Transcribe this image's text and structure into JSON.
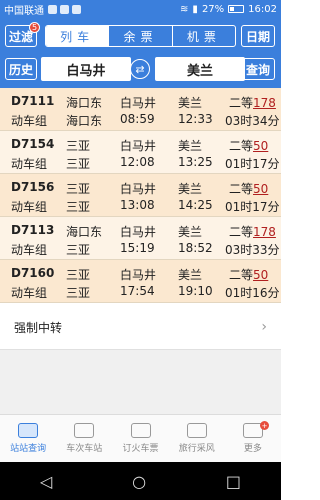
{
  "status_bar": {
    "carrier": "中国联通",
    "battery": "27%",
    "time": "16:02"
  },
  "header": {
    "filter_label": "过滤",
    "filter_badge": "5",
    "tabs": [
      {
        "label": "列车",
        "active": true
      },
      {
        "label": "余票",
        "active": false
      },
      {
        "label": "机票",
        "active": false
      }
    ],
    "date_label": "日期",
    "history_label": "历史",
    "from_station": "白马井",
    "to_station": "美兰",
    "query_label": "查询"
  },
  "trains": [
    {
      "no": "D7111",
      "type": "动车组",
      "start": "海口东",
      "end": "海口东",
      "from": "白马井",
      "depart": "08:59",
      "to": "美兰",
      "arrive": "12:33",
      "seat_class": "二等",
      "seat_count": "178",
      "duration": "03时34分"
    },
    {
      "no": "D7154",
      "type": "动车组",
      "start": "三亚",
      "end": "三亚",
      "from": "白马井",
      "depart": "12:08",
      "to": "美兰",
      "arrive": "13:25",
      "seat_class": "二等",
      "seat_count": "50",
      "duration": "01时17分"
    },
    {
      "no": "D7156",
      "type": "动车组",
      "start": "三亚",
      "end": "三亚",
      "from": "白马井",
      "depart": "13:08",
      "to": "美兰",
      "arrive": "14:25",
      "seat_class": "二等",
      "seat_count": "50",
      "duration": "01时17分"
    },
    {
      "no": "D7113",
      "type": "动车组",
      "start": "海口东",
      "end": "三亚",
      "from": "白马井",
      "depart": "15:19",
      "to": "美兰",
      "arrive": "18:52",
      "seat_class": "二等",
      "seat_count": "178",
      "duration": "03时33分"
    },
    {
      "no": "D7160",
      "type": "动车组",
      "start": "三亚",
      "end": "三亚",
      "from": "白马井",
      "depart": "17:54",
      "to": "美兰",
      "arrive": "19:10",
      "seat_class": "二等",
      "seat_count": "50",
      "duration": "01时16分"
    }
  ],
  "forced_transfer": "强制中转",
  "tabbar": [
    {
      "label": "站站查询",
      "icon": "train-icon",
      "active": true
    },
    {
      "label": "车次车站",
      "icon": "briefcase-icon",
      "active": false
    },
    {
      "label": "订火车票",
      "icon": "ticket-icon",
      "active": false
    },
    {
      "label": "旅行采风",
      "icon": "chat-icon",
      "active": false
    },
    {
      "label": "更多",
      "icon": "grid-icon",
      "active": false
    }
  ],
  "colors": {
    "brand": "#3b7fdc",
    "row_odd": "#fbe8d0",
    "row_even": "#fdf3e6",
    "seat_count": "#b01f1f"
  }
}
